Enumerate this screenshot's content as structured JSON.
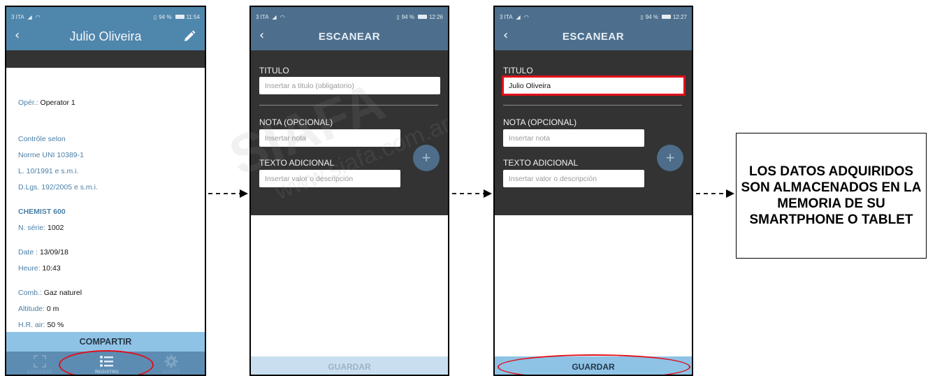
{
  "screen1": {
    "status": {
      "carrier": "3 ITA",
      "battery": "94 %",
      "time": "11:54"
    },
    "title": "Julio Oliveira",
    "details": {
      "operator_label": "Opér.:",
      "operator_value": "Operator 1",
      "control_line1": "Contrôle selon",
      "control_line2": "Norme UNI 10389-1",
      "control_line3": "L. 10/1991 e s.m.i.",
      "control_line4": "D.Lgs. 192/2005 e s.m.i.",
      "device": "CHEMIST 600",
      "serial_label": "N. série:",
      "serial_value": "1002",
      "date_label": "Date :",
      "date_value": "13/09/18",
      "time_label": "Heure:",
      "time_value": "10:43",
      "fuel_label": "Comb.:",
      "fuel_value": "Gaz naturel",
      "altitude_label": "Altitude:",
      "altitude_value": "0 m",
      "hr_label": "H.R. air:",
      "hr_value": "50 %"
    },
    "share_button": "COMPARTIR",
    "tabs": [
      {
        "label": "ESCANEAR",
        "icon": "scan-icon"
      },
      {
        "label": "REGISTRO",
        "icon": "list-icon"
      },
      {
        "label": "AJUSTE",
        "icon": "gear-icon"
      }
    ]
  },
  "screen2": {
    "status": {
      "carrier": "3 ITA",
      "battery": "94 %",
      "time": "12:26"
    },
    "title": "ESCANEAR",
    "title_label": "TITULO",
    "title_placeholder": "Insertar a titulo (obligatorio)",
    "note_label": "NOTA (OPCIONAL)",
    "note_placeholder": "Insertar nota",
    "extra_label": "TEXTO ADICIONAL",
    "extra_placeholder": "Insertar valor o descripción",
    "save_button": "GUARDAR"
  },
  "screen3": {
    "status": {
      "carrier": "3 ITA",
      "battery": "94 %",
      "time": "12:27"
    },
    "title": "ESCANEAR",
    "title_label": "TITULO",
    "title_value": "Julio Oliveira",
    "note_label": "NOTA (OPCIONAL)",
    "note_placeholder": "Insertar nota",
    "extra_label": "TEXTO ADICIONAL",
    "extra_placeholder": "Insertar valor o descripción",
    "save_button": "GUARDAR"
  },
  "watermark": {
    "brand": "SIAFA",
    "url": "www.siafa.com.ar"
  },
  "message": "LOS DATOS ADQUIRIDOS SON ALMACENADOS EN LA MEMORIA DE SU SMARTPHONE O TABLET",
  "colors": {
    "header_blue": "#4f86ac",
    "scan_header": "#4d6f8d",
    "dark_form": "#333333",
    "button_light_blue": "#8ec3e6",
    "highlight_red": "#e0101a"
  }
}
